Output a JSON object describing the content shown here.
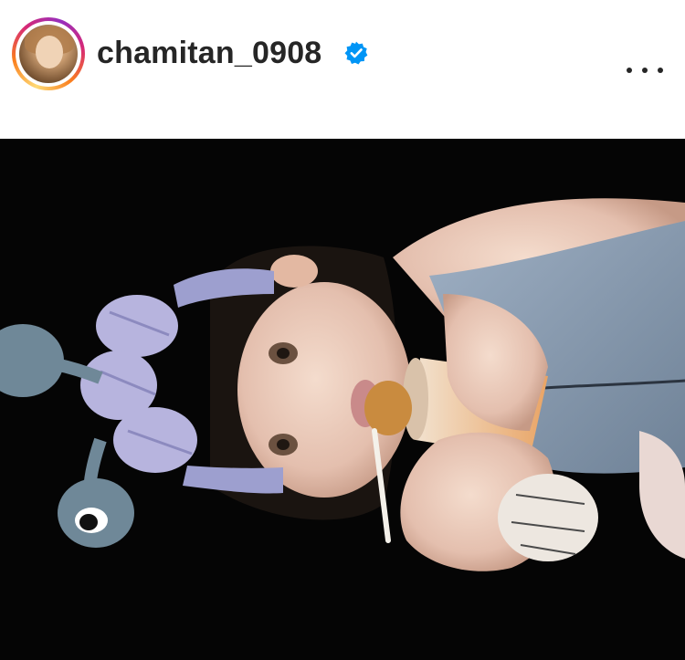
{
  "post_header": {
    "username": "chamitan_0908",
    "verified": true,
    "verified_icon": "verified-badge-icon",
    "more_icon": "more-options-icon",
    "avatar_ring_colors": [
      "#feda75",
      "#fa7e1e",
      "#d62976",
      "#962fbf"
    ]
  },
  "post": {
    "media_type": "photo",
    "background_color": "#050505"
  },
  "colors": {
    "text": "#262626",
    "verified_blue": "#0095f6",
    "background": "#ffffff"
  }
}
